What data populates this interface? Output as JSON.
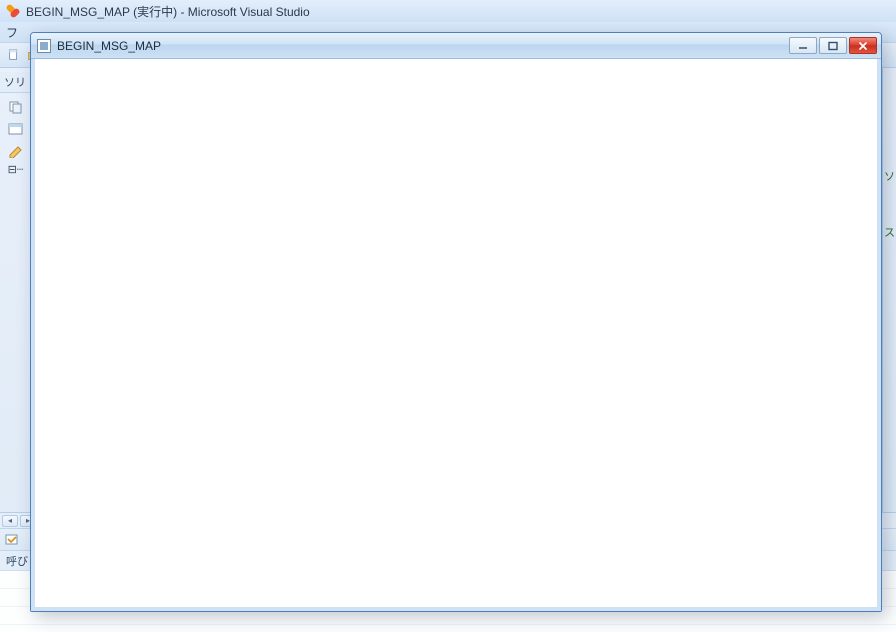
{
  "vs": {
    "title": "BEGIN_MSG_MAP (実行中) - Microsoft Visual Studio",
    "menu_first": "フ",
    "left_panel_label": "ソリ",
    "bottom_tab_label": "呼び",
    "right_hint_1": "ソ",
    "right_hint_2": "ス"
  },
  "child": {
    "title": "BEGIN_MSG_MAP"
  }
}
